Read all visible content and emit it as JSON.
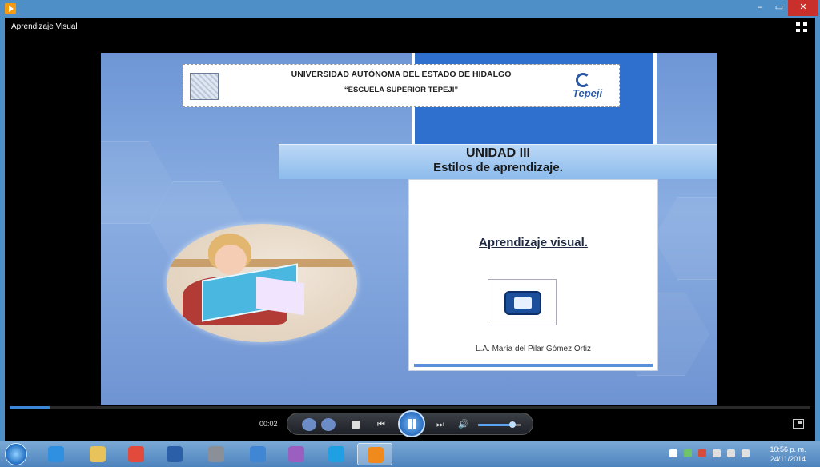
{
  "window": {
    "title": "Aprendizaje Visual",
    "buttons": {
      "minimize": "–",
      "maximize": "▭",
      "close": "✕"
    }
  },
  "slide": {
    "university": "UNIVERSIDAD AUTÓNOMA DEL ESTADO DE HIDALGO",
    "school": "“ESCUELA SUPERIOR TEPEJI”",
    "tepeji_logo_text": "Tepeji",
    "unit_title": "UNIDAD III",
    "unit_subtitle": "Estilos de aprendizaje.",
    "card_heading": "Aprendizaje visual.",
    "author": "L.A. María del Pilar Gómez Ortiz"
  },
  "player": {
    "elapsed": "00:02",
    "progress_fraction": 0.05,
    "volume_fraction": 0.8,
    "controls": {
      "prev": "⏮",
      "next": "⏭",
      "mute": "🔊"
    }
  },
  "taskbar": {
    "items": [
      {
        "name": "internet-explorer",
        "color": "#2f8fe0"
      },
      {
        "name": "file-explorer",
        "color": "#e8c25a"
      },
      {
        "name": "chrome",
        "color": "#e24a3b"
      },
      {
        "name": "word",
        "color": "#2b5fa8"
      },
      {
        "name": "media-app",
        "color": "#8a8f98"
      },
      {
        "name": "paint-app",
        "color": "#3f86d4"
      },
      {
        "name": "messenger",
        "color": "#9b5fc0"
      },
      {
        "name": "skype",
        "color": "#1ea0e3"
      },
      {
        "name": "media-player",
        "color": "#f08a1c",
        "active": true
      }
    ],
    "clock_time": "10:56 p. m.",
    "clock_date": "24/11/2014"
  },
  "colors": {
    "accent": "#2f6fce",
    "titlebar": "#4f8fc7",
    "close": "#c9302c"
  }
}
